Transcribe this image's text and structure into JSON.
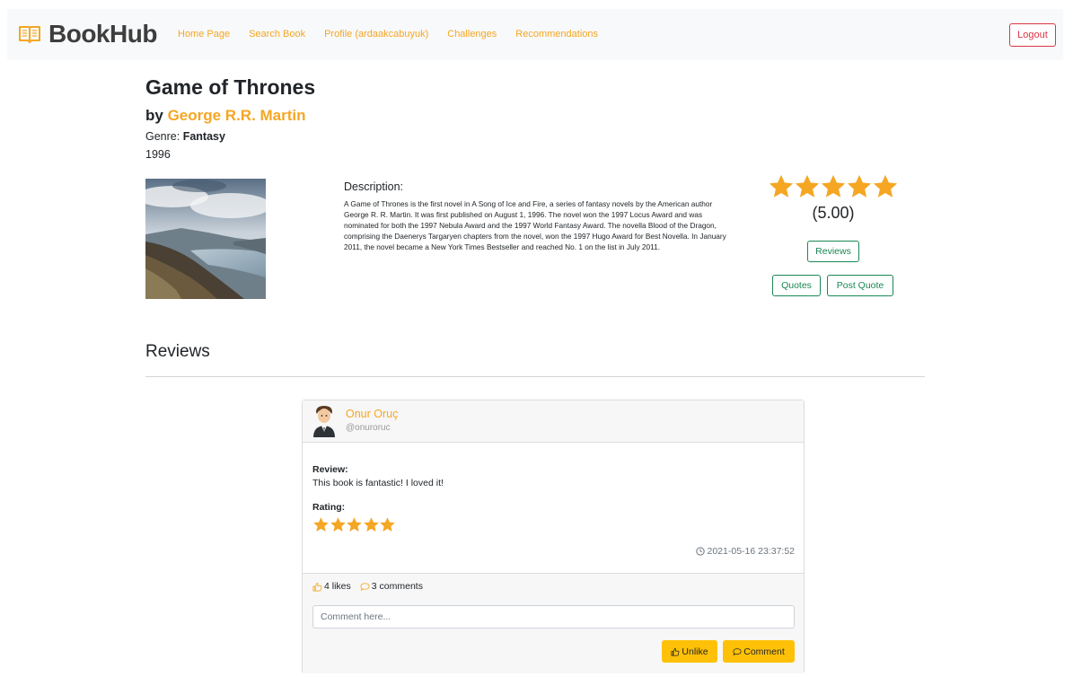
{
  "nav": {
    "brand": "BookHub",
    "brand_icon": "open-book-icon",
    "links": [
      "Home Page",
      "Search Book",
      "Profile (ardaakcabuyuk)",
      "Challenges",
      "Recommendations"
    ],
    "logout": "Logout"
  },
  "colors": {
    "accent": "#f5a623",
    "success": "#198754",
    "danger": "#dc3545",
    "warning": "#ffc107"
  },
  "book": {
    "title": "Game of Thrones",
    "by_prefix": "by ",
    "author": "George R.R. Martin",
    "genre_label": "Genre: ",
    "genre": "Fantasy",
    "year": "1996",
    "description_title": "Description:",
    "description": "A Game of Thrones is the first novel in A Song of Ice and Fire, a series of fantasy novels by the American author George R. R. Martin. It was first published on August 1, 1996. The novel won the 1997 Locus Award and was nominated for both the 1997 Nebula Award and the 1997 World Fantasy Award. The novella Blood of the Dragon, comprising the Daenerys Targaryen chapters from the novel, won the 1997 Hugo Award for Best Novella. In January 2011, the novel became a New York Times Bestseller and reached No. 1 on the list in July 2011.",
    "star_rating": 5,
    "average_rating": "(5.00)",
    "reviews_button": "Reviews",
    "quotes_button": "Quotes",
    "post_quote_button": "Post Quote"
  },
  "reviews_section": {
    "heading": "Reviews",
    "items": [
      {
        "name": "Onur Oruç",
        "handle": "@onuroruc",
        "review_label": "Review:",
        "review_text": "This book is fantastic! I loved it!",
        "rating_label": "Rating:",
        "stars": 5,
        "timestamp": "2021-05-16 23:37:52",
        "likes": "4 likes",
        "comments": "3 comments",
        "comment_placeholder": "Comment here...",
        "unlike_button": "Unlike",
        "comment_button": "Comment"
      }
    ]
  }
}
